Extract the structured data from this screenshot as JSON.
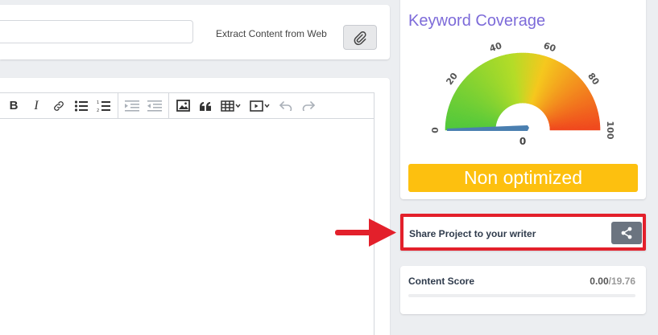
{
  "url_bar": {
    "input_value": "",
    "input_placeholder": "",
    "extract_label": "Extract Content from Web"
  },
  "editor": {
    "toolbar": {
      "bold_label": "B",
      "italic_label": "I"
    }
  },
  "keyword_coverage": {
    "title": "Keyword Coverage",
    "gauge": {
      "tick_labels": [
        "0",
        "20",
        "40",
        "60",
        "80",
        "100"
      ],
      "value": 0,
      "value_label": "0",
      "min": 0,
      "max": 100
    },
    "status": "Non optimized"
  },
  "share_project": {
    "label": "Share Project to your writer"
  },
  "content_score": {
    "label": "Content Score",
    "current": "0.00",
    "total": "/19.76",
    "progress_fraction": 0
  },
  "colors": {
    "accent_purple": "#7d6bd9",
    "status_yellow": "#fdc00f",
    "highlight_red": "#e3202b",
    "gauge_needle": "#4a7fb0"
  },
  "icons": {
    "link": "link-icon",
    "share": "share-icon",
    "arrow": "red-arrow-icon"
  }
}
